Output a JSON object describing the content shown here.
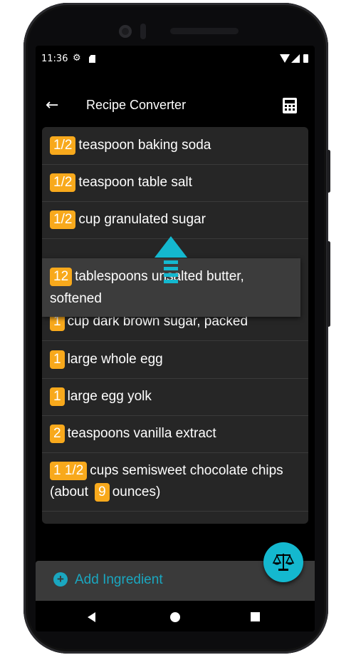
{
  "status_bar": {
    "time": "11:36"
  },
  "app_bar": {
    "back_label": "←",
    "title": "Recipe Converter"
  },
  "ingredients": [
    {
      "qty": "1/2",
      "text": "teaspoon baking soda"
    },
    {
      "qty": "1/2",
      "text": "teaspoon table salt"
    },
    {
      "qty": "1/2",
      "text": "cup granulated sugar"
    },
    {
      "qty": "1",
      "text": "cup dark brown sugar, packed"
    },
    {
      "qty": "1",
      "text": "large whole egg"
    },
    {
      "qty": "1",
      "text": "large egg yolk"
    },
    {
      "qty": "2",
      "text": "teaspoons vanilla extract"
    },
    {
      "qty": "1 1/2",
      "text_before": "cups semisweet chocolate chips (about",
      "inline_qty": "9",
      "text_after": "ounces)"
    }
  ],
  "dragging_item": {
    "qty": "12",
    "text": "tablespoons unsalted butter, softened"
  },
  "add_ingredient": {
    "label": "Add Ingredient"
  },
  "colors": {
    "accent": "#14b8cf",
    "qty_badge": "#f8a91c",
    "list_bg": "#262626"
  },
  "icons": [
    "settings-icon",
    "sim-card-icon",
    "wifi-icon",
    "signal-icon",
    "battery-icon",
    "back-arrow-icon",
    "calculator-icon",
    "drag-up-arrow-icon",
    "add-circle-icon",
    "scale-icon",
    "nav-back-icon",
    "nav-home-icon",
    "nav-recents-icon"
  ]
}
